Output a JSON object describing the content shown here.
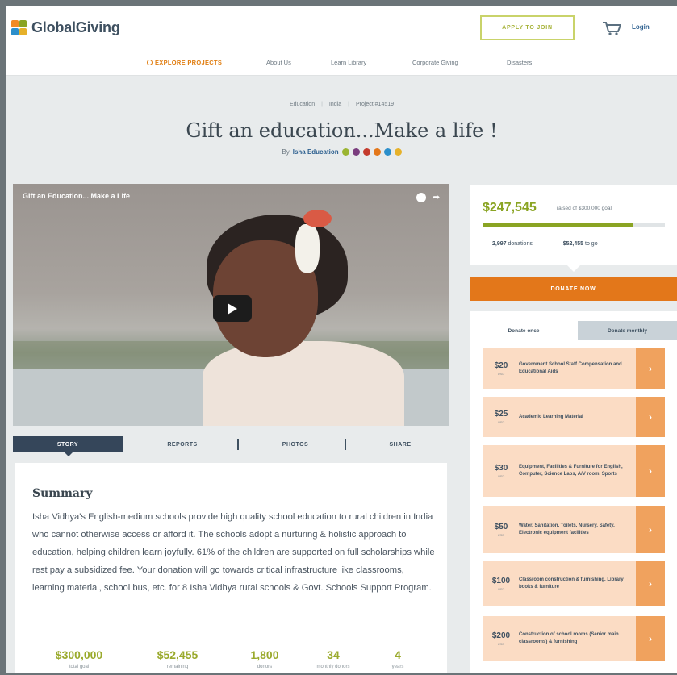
{
  "brand": {
    "name": "GlobalGiving",
    "colors": {
      "orange": "#e3771a",
      "green": "#8aa423",
      "navy": "#35465a"
    }
  },
  "header": {
    "apply_label": "APPLY TO JOIN",
    "login_label": "Login",
    "cart_icon": "cart-icon"
  },
  "nav": {
    "items": [
      {
        "label": "EXPLORE PROJECTS",
        "icon": "search-icon"
      },
      {
        "label": "About Us"
      },
      {
        "label": "Learn Library"
      },
      {
        "label": "Corporate Giving"
      },
      {
        "label": "Disasters"
      }
    ]
  },
  "breadcrumb": {
    "items": [
      "Education",
      "India",
      "Project #14519"
    ]
  },
  "project": {
    "title": "Gift an education...Make a life !",
    "by_prefix": "By",
    "organization": "Isha Education"
  },
  "video": {
    "title": "Gift an Education... Make a Life"
  },
  "tabs": [
    "STORY",
    "REPORTS",
    "PHOTOS",
    "SHARE"
  ],
  "summary": {
    "heading": "Summary",
    "text": "Isha Vidhya's English-medium schools provide high quality school education to rural children in India who cannot otherwise access or afford it. The schools adopt a nurturing & holistic approach to education, helping children learn joyfully. 61% of the children are supported on full scholarships while rest pay a subsidized fee. Your donation will go towards critical infrastructure like classrooms, learning material, school bus, etc. for 8 Isha Vidhya rural schools & Govt. Schools Support Program.",
    "stats": [
      {
        "value": "$300,000",
        "label": "total goal"
      },
      {
        "value": "$52,455",
        "label": "remaining"
      },
      {
        "value": "1,800",
        "label": "donors"
      },
      {
        "value": "34",
        "label": "monthly donors"
      },
      {
        "value": "4",
        "label": "years"
      }
    ]
  },
  "funding": {
    "raised": "$247,545",
    "raised_label": "raised of $300,000 goal",
    "progress_fraction": 0.825,
    "donations_count": "2,997",
    "donations_label": "donations",
    "to_go_amount": "$52,455",
    "to_go_label": "to go"
  },
  "donate": {
    "button_label": "DONATE NOW",
    "tab_once": "Donate once",
    "tab_monthly": "Donate monthly",
    "currency_label": "USD",
    "options": [
      {
        "amount": "$20",
        "desc": "Government School Staff Compensation and Educational Aids"
      },
      {
        "amount": "$25",
        "desc": "Academic Learning Material"
      },
      {
        "amount": "$30",
        "desc": "Equipment, Facilities & Furniture for English, Computer, Science Labs, A/V room, Sports"
      },
      {
        "amount": "$50",
        "desc": "Water, Sanitation, Toilets, Nursery, Safety, Electronic equipment facilities"
      },
      {
        "amount": "$100",
        "desc": "Classroom construction & furnishing, Library books & furniture"
      },
      {
        "amount": "$200",
        "desc": "Construction of school rooms (Senior main classrooms) & furnishing"
      }
    ]
  }
}
